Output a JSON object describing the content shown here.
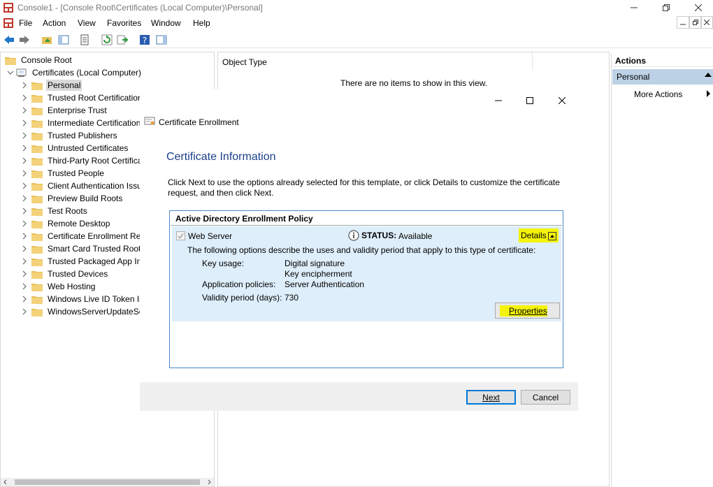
{
  "window": {
    "title": "Console1 - [Console Root\\Certificates (Local Computer)\\Personal]",
    "minimize_icon": "minimize-icon",
    "restore_icon": "restore-icon",
    "close_icon": "close-icon"
  },
  "menubar": {
    "items": [
      "File",
      "Action",
      "View",
      "Favorites",
      "Window",
      "Help"
    ]
  },
  "tree": {
    "root": "Console Root",
    "store": "Certificates (Local Computer)",
    "items": [
      "Personal",
      "Trusted Root Certification",
      "Enterprise Trust",
      "Intermediate Certification",
      "Trusted Publishers",
      "Untrusted Certificates",
      "Third-Party Root Certifica",
      "Trusted People",
      "Client Authentication Issu",
      "Preview Build Roots",
      "Test Roots",
      "Remote Desktop",
      "Certificate Enrollment Re",
      "Smart Card Trusted Roots",
      "Trusted Packaged App Ins",
      "Trusted Devices",
      "Web Hosting",
      "Windows Live ID Token Iss",
      "WindowsServerUpdateSer"
    ],
    "selected": "Personal"
  },
  "center": {
    "column_header": "Object Type",
    "empty_message": "There are no items to show in this view."
  },
  "actions": {
    "header": "Actions",
    "section": "Personal",
    "more": "More Actions"
  },
  "dialog": {
    "title": "Certificate Enrollment",
    "heading": "Certificate Information",
    "intro": "Click Next to use the options already selected for this template, or click Details to customize the certificate request, and then click Next.",
    "policy_title": "Active Directory Enrollment Policy",
    "certificate": "Web Server",
    "status_label": "STATUS:",
    "status_value": "Available",
    "details_label": "Details",
    "description": "The following options describe the uses and validity period that apply to this type of certificate:",
    "key_usage_label": "Key usage:",
    "key_usage_values": [
      "Digital signature",
      "Key encipherment"
    ],
    "app_policies_label": "Application policies:",
    "app_policies_value": "Server Authentication",
    "validity_label": "Validity period (days):",
    "validity_value": "730",
    "properties_button": "Properties",
    "next_button": "Next",
    "cancel_button": "Cancel"
  },
  "colors": {
    "heading_blue": "#1a3f8a",
    "highlight_yellow": "#f4f40a",
    "cert_area_blue": "#deeefa",
    "actions_section": "#bcd1e6"
  }
}
